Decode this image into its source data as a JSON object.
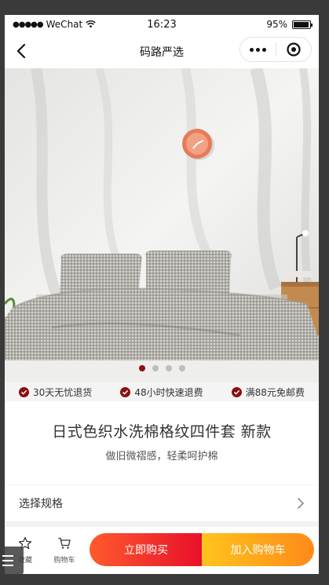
{
  "status_bar": {
    "carrier": "WeChat",
    "time": "16:23",
    "battery": "95%",
    "battery_level": 0.95
  },
  "nav": {
    "title": "码路严选"
  },
  "hero": {
    "slide_count": 4,
    "active_index": 0
  },
  "services": [
    {
      "label": "30天无忧退货"
    },
    {
      "label": "48小时快速退费"
    },
    {
      "label": "满88元免邮费"
    }
  ],
  "product": {
    "title": "日式色织水洗棉格纹四件套 新款",
    "description": "做旧微褶感，轻柔呵护棉"
  },
  "spec": {
    "label": "选择规格"
  },
  "toolbar": {
    "favorite_label": "收藏",
    "cart_label": "购物车",
    "buy_now_label": "立即购买",
    "add_cart_label": "加入购物车"
  },
  "colors": {
    "accent": "#8b1010",
    "buy_gradient_start": "#ff5a2d",
    "buy_gradient_end": "#e8102a",
    "cart_gradient_start": "#ffc41d",
    "cart_gradient_end": "#ff8a19"
  }
}
